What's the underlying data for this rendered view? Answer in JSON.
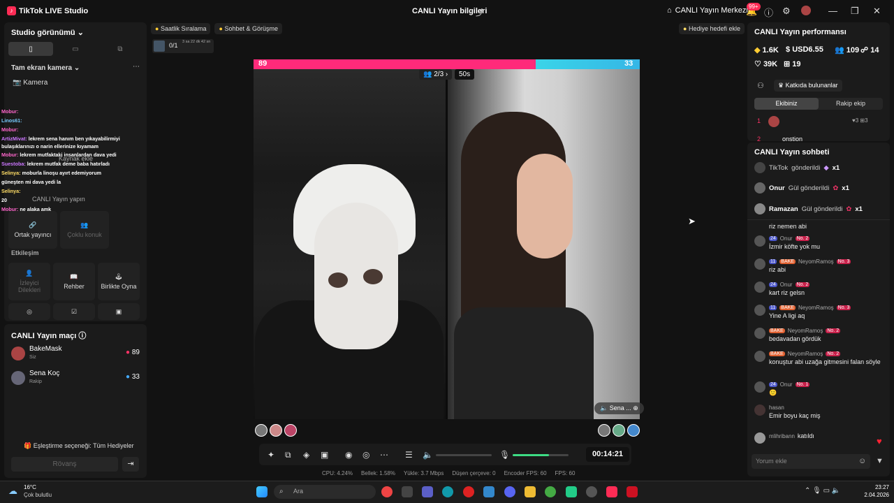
{
  "titlebar": {
    "app": "TikTok LIVE Studio",
    "center": "CANLI Yayın bilgileri",
    "live_center": "CANLI Yayın Merkezi",
    "notif_badge": "99+"
  },
  "left": {
    "studio_view": "Studio görünümü",
    "camera_section": "Tam ekran kamera",
    "camera": "Kamera",
    "add_source": "Kaynak ekle",
    "prompt": "CANLI Yayın yapın",
    "chat_overlay": [
      {
        "name": "Mobur:",
        "text": ""
      },
      {
        "name": "Linos61:",
        "text": ""
      },
      {
        "name": "Mobur:",
        "text": ""
      },
      {
        "name": "ArtizMivat:",
        "text": "lekrem sena hanım ben yıkayabilirmiyi"
      },
      {
        "name": "",
        "text": "bulaşıklarınızı o narin ellerinize kıyamam"
      },
      {
        "name": "Mobur:",
        "text": "lekrem mutfaktaki insanlardan dava yedi"
      },
      {
        "name": "Suestoba:",
        "text": "lekrem mutfak deme baba hatırladı"
      },
      {
        "name": "Selinya:",
        "text": "moburla linoşu ayırt edemiyorum"
      },
      {
        "name": "",
        "text": "güneşten mi dava yedi la"
      },
      {
        "name": "Selinya:",
        "text": ""
      },
      {
        "name": "",
        "text": "20"
      },
      {
        "name": "Mobur:",
        "text": "ne alaka amk"
      }
    ],
    "tiles_top": [
      {
        "label": "Ortak yayıncı"
      },
      {
        "label": "Çoklu konuk"
      }
    ],
    "interaction": "Etkileşim",
    "tiles": [
      {
        "label": "İzleyici Dilekleri"
      },
      {
        "label": "Rehber"
      },
      {
        "label": "Birlikte Oyna"
      }
    ],
    "match_title": "CANLI Yayın maçı",
    "players": [
      {
        "name": "BakeMask",
        "sub": "Siz",
        "score": "89"
      },
      {
        "name": "Sena Koç",
        "sub": "Rakip",
        "score": "33"
      }
    ],
    "pairing": "Eşleştirme seçeneği: Tüm Hediyeler",
    "rematch": "Rövanş"
  },
  "top_chips": {
    "hourly": "Saatlik Sıralama",
    "chat": "Sohbet & Görüşme",
    "counter": "0/1",
    "timer": "3 sa 22 dk 42 sn",
    "gift_goal": "Hediye hedefi ekle"
  },
  "battle": {
    "left_score": "89",
    "right_score": "33",
    "round": "2/3",
    "countdown": "50s",
    "left_fraction": 0.73,
    "guest": "Sena ...",
    "time": "00:14:21"
  },
  "stats": [
    "CPU: 4.24%",
    "Bellek: 1.58%",
    "Yükle: 3.7 Mbps",
    "Düşen çerçeve: 0",
    "Encoder FPS: 60",
    "FPS: 60"
  ],
  "right": {
    "performance": "CANLI Yayın performansı",
    "diamonds": "1.6K",
    "usd": "USD6.55",
    "viewers": "109",
    "followers": "14",
    "likes": "39K",
    "gifts": "19",
    "contributors": "Katkıda bulunanlar",
    "tab_team": "Ekibiniz",
    "tab_rival": "Rakip ekip",
    "rank1_likes": "3",
    "rank1_gifts": "3",
    "rank2_name": "onstion",
    "chat_title": "CANLI Yayın sohbeti",
    "gift_rows": [
      {
        "name": "TikTok",
        "action": "gönderildi",
        "count": "x1"
      },
      {
        "name": "Onur",
        "action": "Gül gönderildi",
        "count": "x1"
      },
      {
        "name": "Ramazan",
        "action": "Gül gönderildi",
        "count": "x1"
      }
    ],
    "messages": [
      {
        "meta": "",
        "lv": "",
        "tag": "",
        "nb": "",
        "text": "riz nemen abi"
      },
      {
        "meta": "Onur",
        "lv": "24",
        "tag": "",
        "nb": "No. 2",
        "text": "İzmir köfte yok mu"
      },
      {
        "meta": "NeyomRamoş",
        "lv": "11",
        "tag": "BAKE",
        "nb": "No. 3",
        "text": "riz abi"
      },
      {
        "meta": "Onur",
        "lv": "24",
        "tag": "",
        "nb": "No. 2",
        "text": "kart riz gelsn"
      },
      {
        "meta": "NeyomRamoş",
        "lv": "11",
        "tag": "BAKE",
        "nb": "No. 3",
        "text": "Yine A ligi aq"
      },
      {
        "meta": "NeyomRamoş",
        "lv": "",
        "tag": "BAKE",
        "nb": "No. 2",
        "text": "bedavadan gördük"
      },
      {
        "meta": "NeyomRamoş",
        "lv": "",
        "tag": "BAKE",
        "nb": "No. 2",
        "text": "konuştur abi uzağa gitmesini falan söyle"
      },
      {
        "meta": "Onur",
        "lv": "24",
        "tag": "",
        "nb": "No. 1",
        "text": ""
      },
      {
        "meta": "hasan",
        "lv": "",
        "tag": "",
        "nb": "",
        "text": "Emir boyu kaç miş"
      },
      {
        "meta": "mlihribann",
        "lv": "",
        "tag": "",
        "nb": "",
        "text": "katıldı"
      }
    ],
    "comment_placeholder": "Yorum ekle"
  },
  "taskbar": {
    "temp": "16°C",
    "weather": "Çok bulutlu",
    "search": "Ara",
    "time": "23:27",
    "date": "2.04.2026"
  }
}
